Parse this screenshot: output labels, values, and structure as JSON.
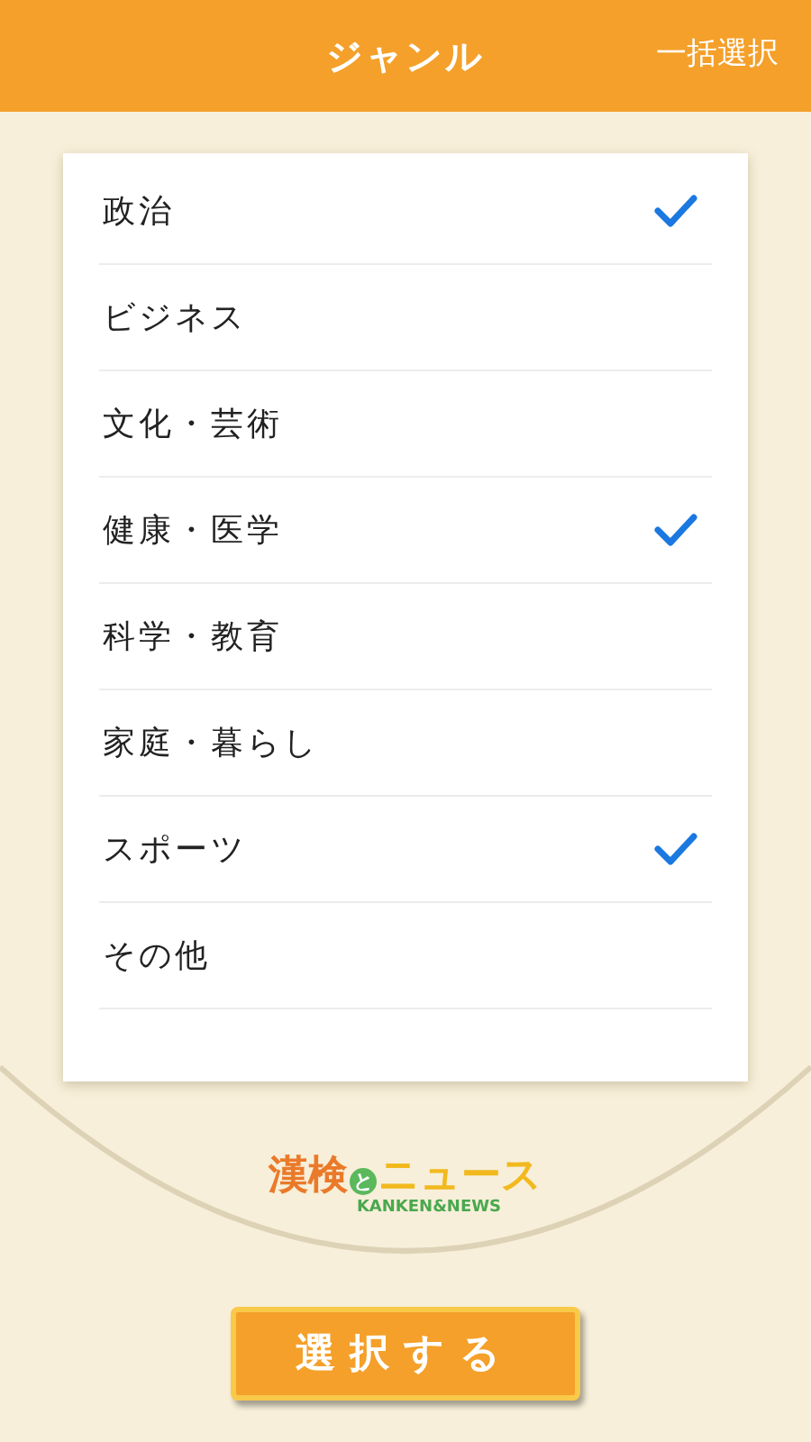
{
  "header": {
    "title": "ジャンル",
    "action": "一括選択"
  },
  "genres": [
    {
      "label": "政治",
      "checked": true
    },
    {
      "label": "ビジネス",
      "checked": false
    },
    {
      "label": "文化・芸術",
      "checked": false
    },
    {
      "label": "健康・医学",
      "checked": true
    },
    {
      "label": "科学・教育",
      "checked": false
    },
    {
      "label": "家庭・暮らし",
      "checked": false
    },
    {
      "label": "スポーツ",
      "checked": true
    },
    {
      "label": "その他",
      "checked": false
    }
  ],
  "logo": {
    "kanji": "漢検",
    "connector": "と",
    "katakana": "ニュース",
    "subtitle": "KANKEN&NEWS"
  },
  "button": "選択する"
}
